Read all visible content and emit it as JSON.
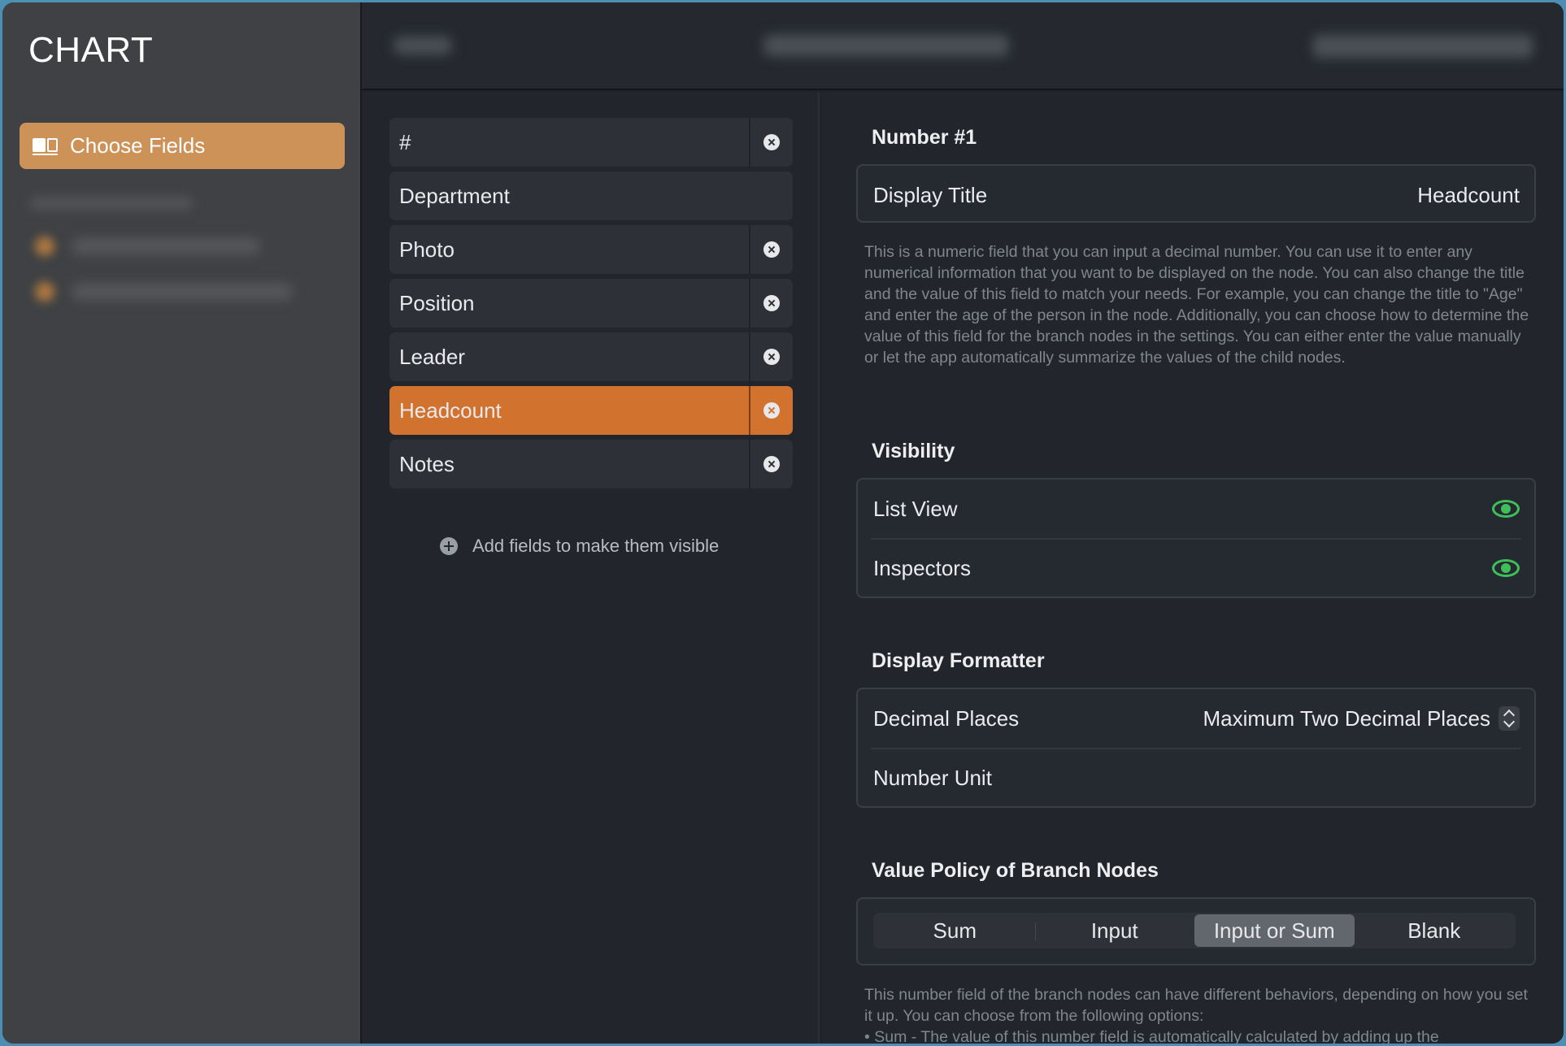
{
  "sidebar": {
    "brand": "CHART",
    "nav": {
      "choose_fields_label": "Choose Fields"
    }
  },
  "fields": {
    "items": [
      {
        "label": "#",
        "removable": true
      },
      {
        "label": "Department",
        "removable": false
      },
      {
        "label": "Photo",
        "removable": true
      },
      {
        "label": "Position",
        "removable": true
      },
      {
        "label": "Leader",
        "removable": true
      },
      {
        "label": "Headcount",
        "removable": true,
        "selected": true
      },
      {
        "label": "Notes",
        "removable": true
      }
    ],
    "add_hint": "Add fields to make them visible"
  },
  "inspector": {
    "field_heading": "Number #1",
    "display_title_label": "Display Title",
    "display_title_value": "Headcount",
    "description": "This is a numeric field that you can input a decimal number. You can use it to enter any numerical information that you want to be displayed on the node. You can also change the title and the value of this field to match your needs. For example, you can change the title to \"Age\" and enter the age of the person in the node. Additionally, you can choose how to determine the value of this field for the branch nodes in the settings. You can either enter the value manually or let the app automatically summarize the values of the child nodes.",
    "visibility": {
      "heading": "Visibility",
      "list_view_label": "List View",
      "inspectors_label": "Inspectors"
    },
    "formatter": {
      "heading": "Display Formatter",
      "decimal_places_label": "Decimal Places",
      "decimal_places_value": "Maximum Two Decimal Places",
      "number_unit_label": "Number Unit"
    },
    "value_policy": {
      "heading": "Value Policy of Branch Nodes",
      "options": [
        "Sum",
        "Input",
        "Input or Sum",
        "Blank"
      ],
      "selected": "Input or Sum",
      "description_line1": "This number field of the branch nodes can have different behaviors, depending on how you set it up. You can choose from the following options:",
      "description_line2": "• Sum - The value of this number field is automatically calculated by adding up the"
    }
  },
  "colors": {
    "accent_nav": "#cd9257",
    "accent_selected": "#d2722f",
    "eye_green": "#3fbf5a"
  }
}
